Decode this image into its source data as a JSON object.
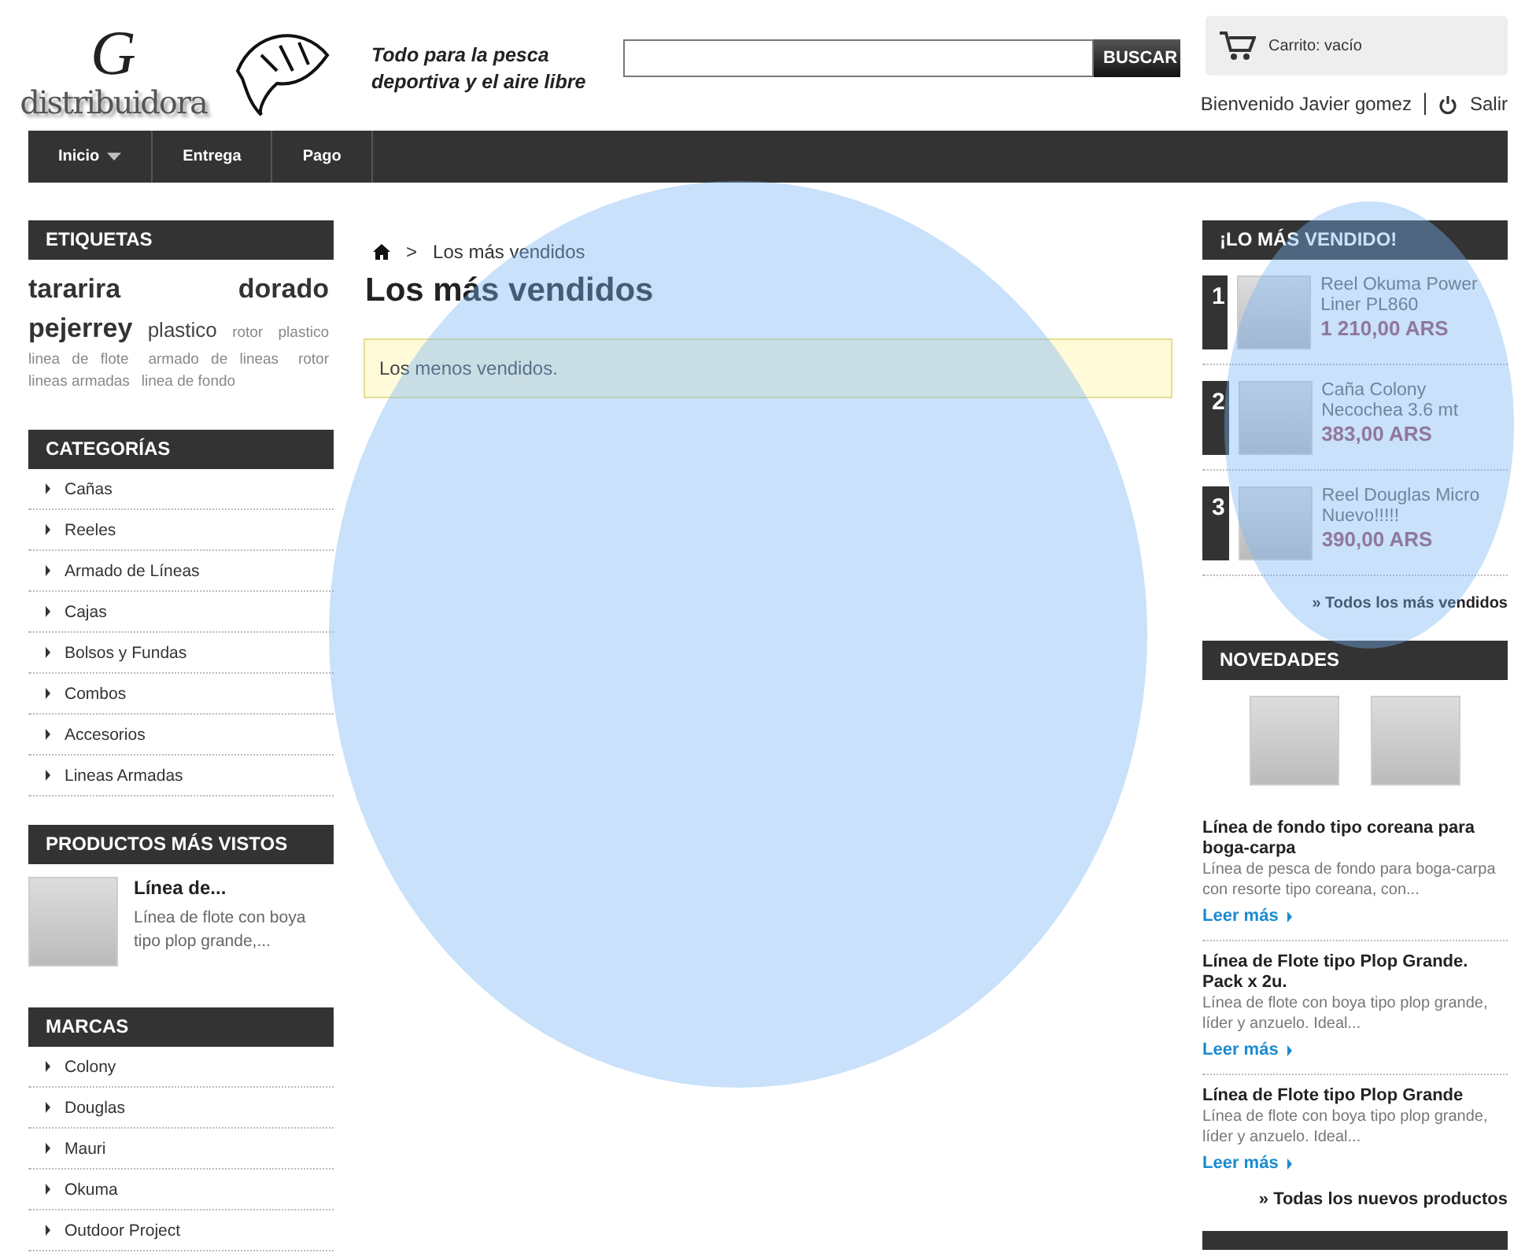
{
  "header": {
    "logo": {
      "word": "distribuidora",
      "letter": "G"
    },
    "tagline": [
      "Todo para la pesca",
      "deportiva y el aire libre"
    ],
    "search": {
      "button": "BUSCAR"
    },
    "cart": {
      "label": "Carrito: vacío"
    },
    "user": {
      "welcome": "Bienvenido Javier gomez",
      "logout": "Salir"
    }
  },
  "nav": [
    {
      "label": "Inicio",
      "dropdown": true
    },
    {
      "label": "Entrega",
      "dropdown": false
    },
    {
      "label": "Pago",
      "dropdown": false
    }
  ],
  "left": {
    "tags": {
      "title": "ETIQUETAS",
      "items": [
        {
          "label": "tararira",
          "kind": "large"
        },
        {
          "label": "dorado",
          "kind": "large"
        },
        {
          "label": "pejerrey",
          "kind": "large"
        },
        {
          "label": "plastico",
          "kind": "medium"
        },
        {
          "label": "rotor",
          "kind": "small"
        },
        {
          "label": "plastico",
          "kind": "small"
        },
        {
          "label": "linea de flote",
          "kind": "small"
        },
        {
          "label": "armado de lineas",
          "kind": "small"
        },
        {
          "label": "rotor",
          "kind": "small"
        },
        {
          "label": "lineas armadas",
          "kind": "small"
        },
        {
          "label": "linea de fondo",
          "kind": "small"
        }
      ]
    },
    "categories": {
      "title": "CATEGORÍAS",
      "items": [
        "Cañas",
        "Reeles",
        "Armado de Líneas",
        "Cajas",
        "Bolsos y Fundas",
        "Combos",
        "Accesorios",
        "Lineas Armadas"
      ]
    },
    "most_viewed": {
      "title": "PRODUCTOS MÁS VISTOS",
      "items": [
        {
          "name": "Línea de...",
          "description": "Línea de flote con boya tipo plop grande,..."
        }
      ]
    },
    "brands": {
      "title": "MARCAS",
      "items": [
        "Colony",
        "Douglas",
        "Mauri",
        "Okuma",
        "Outdoor Project"
      ]
    }
  },
  "main": {
    "breadcrumb_separator": ">",
    "breadcrumb": "Los más vendidos",
    "title": "Los más vendidos",
    "notice": "Los menos vendidos."
  },
  "right": {
    "bestsellers": {
      "title": "¡LO MÁS VENDIDO!",
      "items": [
        {
          "rank": "1",
          "name": "Reel Okuma Power Liner PL860",
          "price": "1 210,00 ARS"
        },
        {
          "rank": "2",
          "name": "Caña Colony Necochea 3.6 mt",
          "price": "383,00 ARS"
        },
        {
          "rank": "3",
          "name": "Reel Douglas Micro Nuevo!!!!!",
          "price": "390,00 ARS"
        }
      ],
      "link": "» Todos los más vendidos"
    },
    "new": {
      "title": "NOVEDADES",
      "items": [
        {
          "name": "Línea de fondo tipo coreana para boga-carpa",
          "description": "Línea de pesca de fondo para boga-carpa con resorte tipo coreana, con...",
          "link": "Leer más"
        },
        {
          "name": "Línea de Flote tipo Plop Grande. Pack x 2u.",
          "description": "Línea de flote con boya tipo plop grande, líder y anzuelo. Ideal...",
          "link": "Leer más"
        },
        {
          "name": "Línea de Flote tipo Plop Grande",
          "description": "Línea de flote con boya tipo plop grande, líder y anzuelo. Ideal...",
          "link": "Leer más"
        }
      ],
      "link": "» Todas los nuevos productos"
    }
  }
}
